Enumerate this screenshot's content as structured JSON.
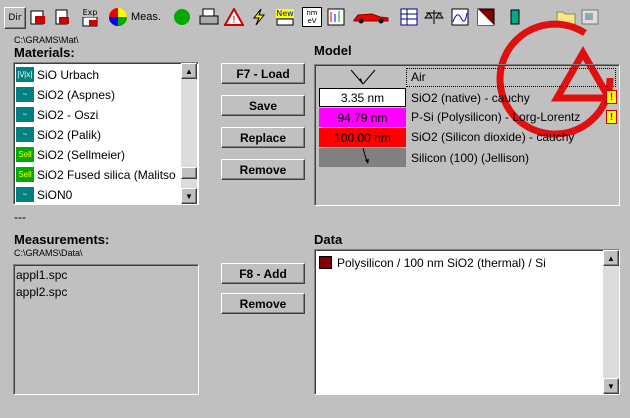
{
  "toolbar": {
    "dir_label": "Dir",
    "exp_label": "Exp",
    "meas_label": "Meas.",
    "new_label": "New",
    "nm_ev_label": "nm\neV",
    "icons": [
      "dir-icon",
      "open-icon",
      "print-report-icon",
      "export-icon",
      "meas-color-wheel-icon",
      "record-green-icon",
      "printer-icon",
      "warning-icon",
      "lightning-icon",
      "new-icon",
      "nm-ev-icon",
      "spectrum-icon",
      "car-icon",
      "table-icon",
      "balance-icon",
      "fit-icon",
      "mask-icon",
      "beaker-icon",
      "folder-icon",
      "window-icon"
    ]
  },
  "materials": {
    "path": "C:\\GRAMS\\Mat\\",
    "heading": "Materials:",
    "items": [
      {
        "icon_text": "|\\/|x|",
        "label": "SiO Urbach"
      },
      {
        "icon_text": "~",
        "label": "SiO2  (Aspnes)"
      },
      {
        "icon_text": "~",
        "label": "SiO2 - Oszi"
      },
      {
        "icon_text": "~",
        "label": "SiO2  (Palik)"
      },
      {
        "icon_text": "Sell",
        "label": "SiO2 (Sellmeier)"
      },
      {
        "icon_text": "Sell",
        "label": "SiO2 Fused silica (Malitso"
      },
      {
        "icon_text": "~",
        "label": "SiON0"
      }
    ]
  },
  "buttons": {
    "load": "F7 - Load",
    "save": "Save",
    "replace": "Replace",
    "remove": "Remove",
    "add": "F8 - Add",
    "remove2": "Remove"
  },
  "separator": "---",
  "measurements": {
    "heading": "Measurements:",
    "path": "C:\\GRAMS\\Data\\",
    "items": [
      "appl1.spc",
      "appl2.spc"
    ]
  },
  "model": {
    "heading": "Model",
    "layers": [
      {
        "thickness": "",
        "label": "Air",
        "color": "#ffffff",
        "warn": false
      },
      {
        "thickness": "3.35 nm",
        "label": "SiO2 (native) - cauchy",
        "color": "#ffffff",
        "warn": true
      },
      {
        "thickness": "94.79 nm",
        "label": "P-Si (Polysilicon) - Lorg-Lorentz",
        "color": "#ff00ff",
        "warn": true
      },
      {
        "thickness": "100.00 nm",
        "label": "SiO2 (Silicon dioxide) - cauchy",
        "color": "#ff0000",
        "warn": false
      },
      {
        "thickness": "",
        "label": "Silicon (100) (Jellison)",
        "color": "#808080",
        "warn": false
      }
    ],
    "warn_symbol": "!"
  },
  "data": {
    "heading": "Data",
    "items": [
      {
        "label": "Polysilicon / 100 nm SiO2 (thermal) / Si",
        "color": "#800000"
      }
    ]
  }
}
